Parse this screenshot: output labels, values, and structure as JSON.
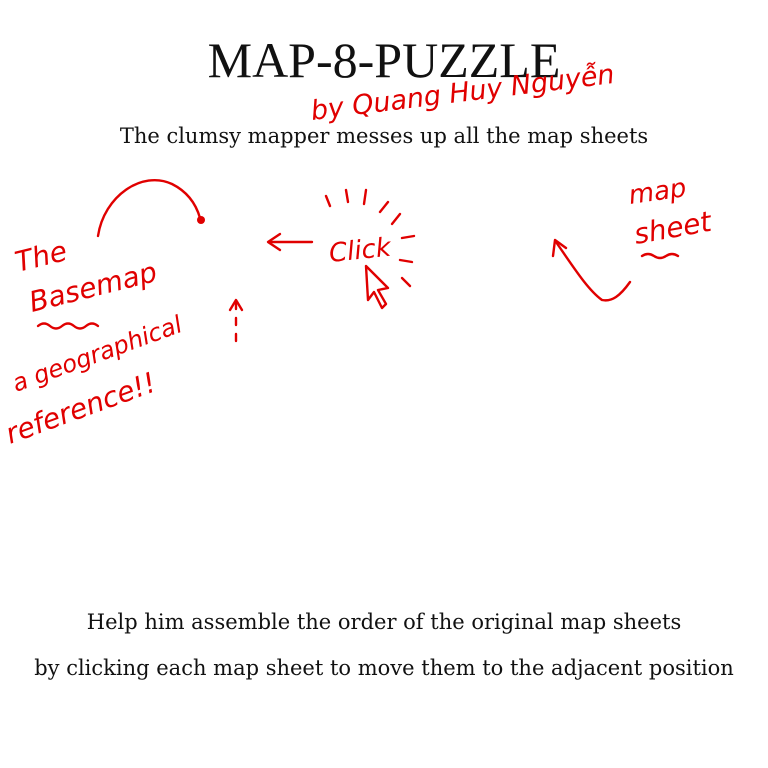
{
  "title": "MAP-8-PUZZLE",
  "byline": "by Quang Huy Nguyễn",
  "subtitle": "The clumsy mapper messes up all the map sheets",
  "instructions": {
    "line1": "Help him assemble the order of the original map sheets",
    "line2": "by clicking each map sheet to move them to the adjacent position"
  },
  "annotations": {
    "basemap_line1": "The",
    "basemap_line2": "Basemap",
    "basemap_line3": "a geographical",
    "basemap_line4": "reference!!",
    "click": "Click",
    "mapsheet_line1": "map",
    "mapsheet_line2": "sheet"
  },
  "colors": {
    "annotation": "#e00000",
    "text": "#111111",
    "background": "#ffffff"
  },
  "icons": {
    "cursor": "cursor-arrow-icon",
    "arrow_left": "arrow-left-icon",
    "arrow_up": "arrow-up-icon"
  }
}
